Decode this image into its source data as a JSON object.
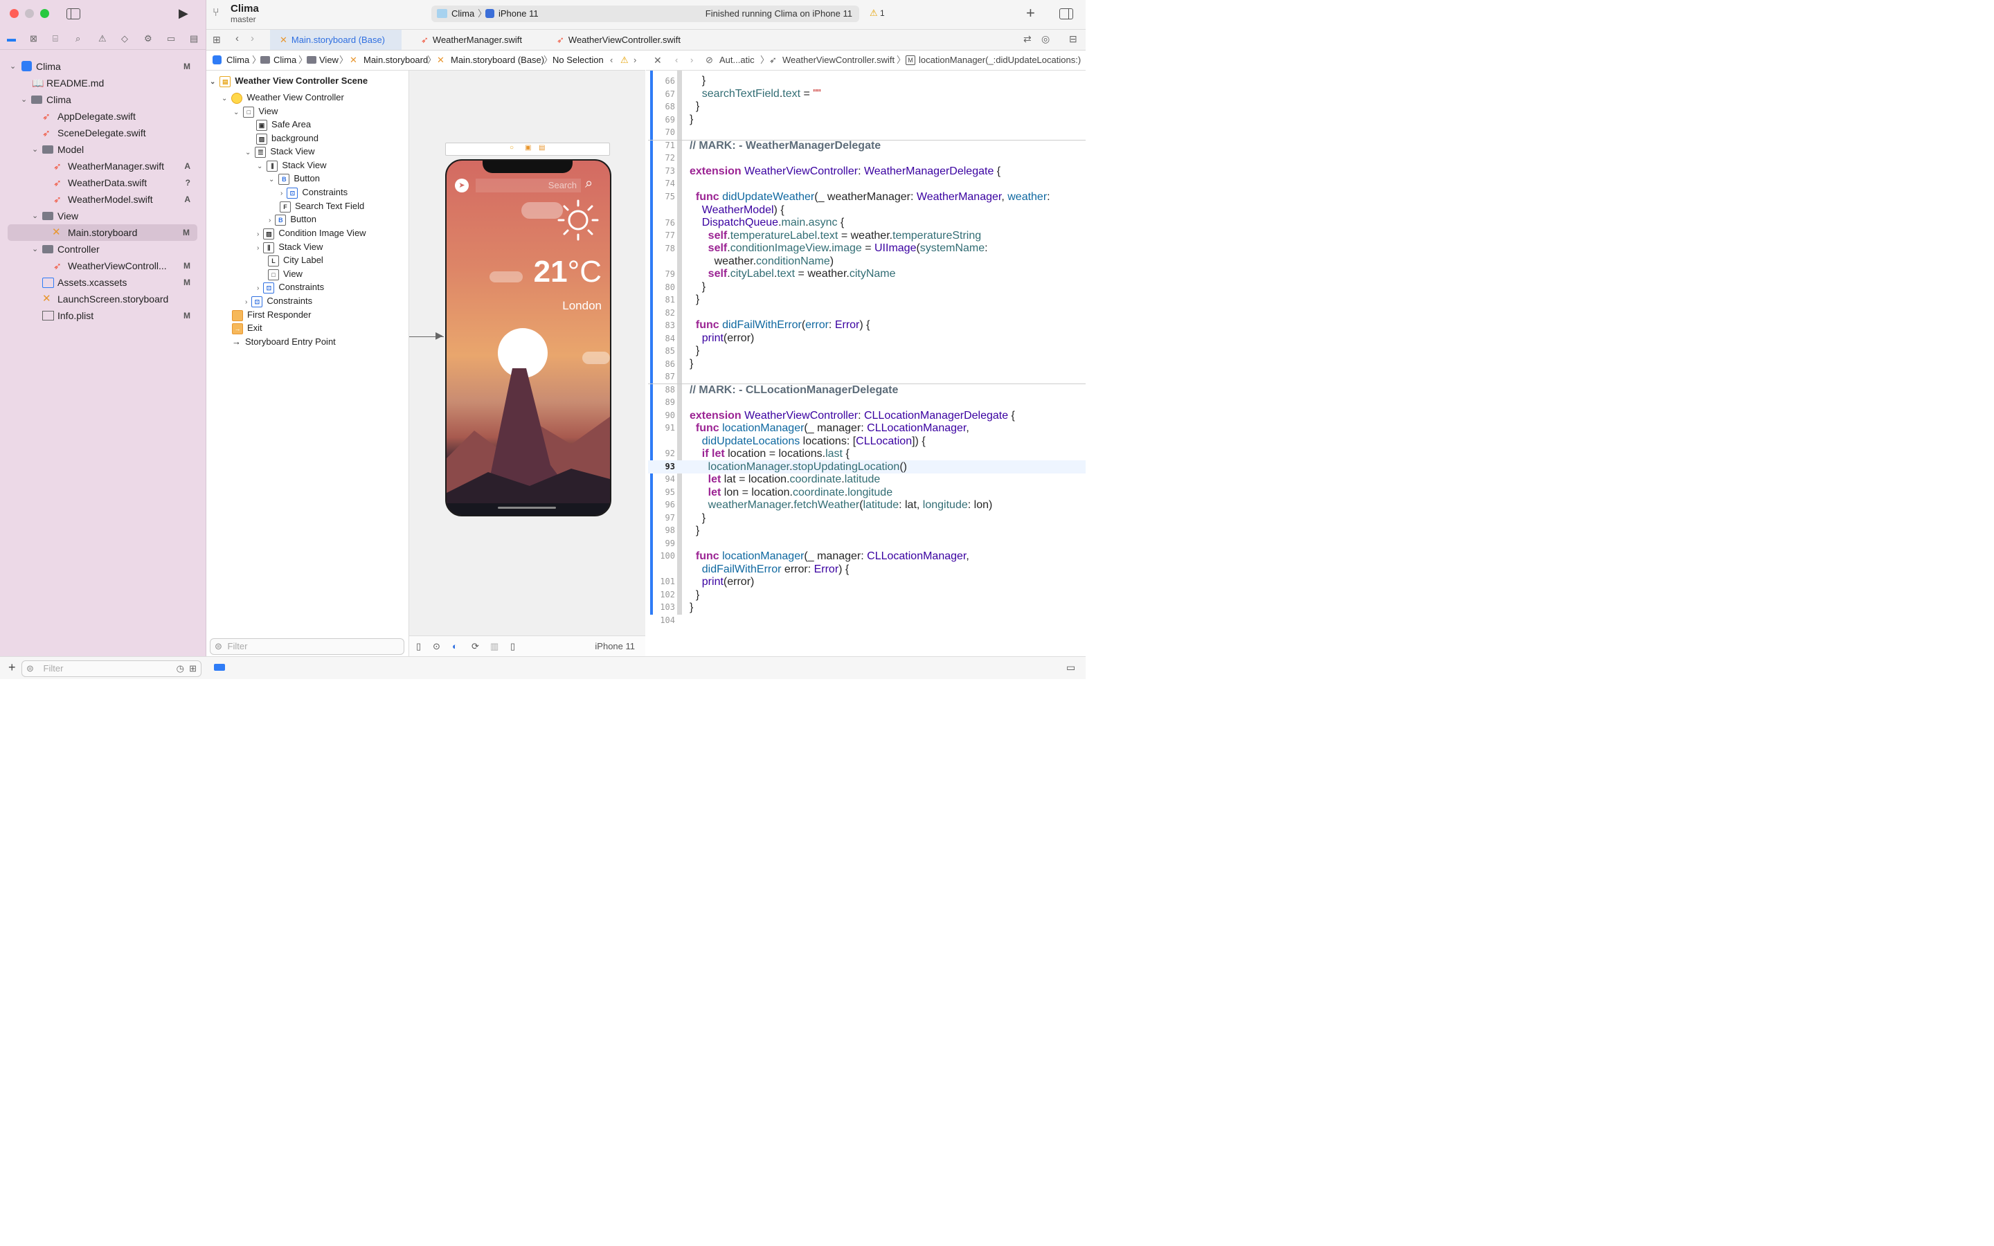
{
  "toolbar": {
    "project_name": "Clima",
    "branch": "master",
    "scheme": "Clima",
    "device": "iPhone 11",
    "status": "Finished running Clima on iPhone 11",
    "warnings": "1"
  },
  "tabs": [
    "Main.storyboard (Base)",
    "WeatherManager.swift",
    "WeatherViewController.swift"
  ],
  "jumpbar": {
    "crumbs": [
      "Clima",
      "Clima",
      "View",
      "Main.storyboard",
      "Main.storyboard (Base)",
      "No Selection"
    ]
  },
  "jumpbar2": {
    "crumbs": [
      "Aut...atic",
      "WeatherViewController.swift",
      "locationManager(_:didUpdateLocations:)"
    ]
  },
  "navigator": {
    "items": [
      {
        "label": "Clima",
        "badge": "M"
      },
      {
        "label": "README.md",
        "badge": ""
      },
      {
        "label": "Clima",
        "badge": ""
      },
      {
        "label": "AppDelegate.swift",
        "badge": ""
      },
      {
        "label": "SceneDelegate.swift",
        "badge": ""
      },
      {
        "label": "Model",
        "badge": ""
      },
      {
        "label": "WeatherManager.swift",
        "badge": "A"
      },
      {
        "label": "WeatherData.swift",
        "badge": "?"
      },
      {
        "label": "WeatherModel.swift",
        "badge": "A"
      },
      {
        "label": "View",
        "badge": ""
      },
      {
        "label": "Main.storyboard",
        "badge": "M"
      },
      {
        "label": "Controller",
        "badge": ""
      },
      {
        "label": "WeatherViewControll...",
        "badge": "M"
      },
      {
        "label": "Assets.xcassets",
        "badge": "M"
      },
      {
        "label": "LaunchScreen.storyboard",
        "badge": ""
      },
      {
        "label": "Info.plist",
        "badge": "M"
      }
    ],
    "filter_placeholder": "Filter"
  },
  "outline": {
    "items": [
      "Weather View Controller Scene",
      "Weather View Controller",
      "View",
      "Safe Area",
      "background",
      "Stack View",
      "Stack View",
      "Button",
      "Constraints",
      "Search Text Field",
      "Button",
      "Condition Image View",
      "Stack View",
      "City Label",
      "View",
      "Constraints",
      "Constraints",
      "First Responder",
      "Exit",
      "Storyboard Entry Point"
    ],
    "filter_placeholder": "Filter"
  },
  "canvas": {
    "device": "iPhone 11",
    "search_placeholder": "Search",
    "temperature": "21",
    "unit": "°C",
    "city": "London"
  },
  "code": {
    "line_numbers": [
      "66",
      "67",
      "68",
      "69",
      "70",
      "71",
      "72",
      "73",
      "74",
      "75",
      "",
      "76",
      "77",
      "78",
      "",
      "79",
      "80",
      "81",
      "82",
      "83",
      "84",
      "85",
      "86",
      "87",
      "88",
      "89",
      "90",
      "91",
      "",
      "92",
      "93",
      "94",
      "95",
      "96",
      "97",
      "98",
      "99",
      "100",
      "",
      "101",
      "102",
      "103",
      "104"
    ],
    "current_line": "93"
  }
}
